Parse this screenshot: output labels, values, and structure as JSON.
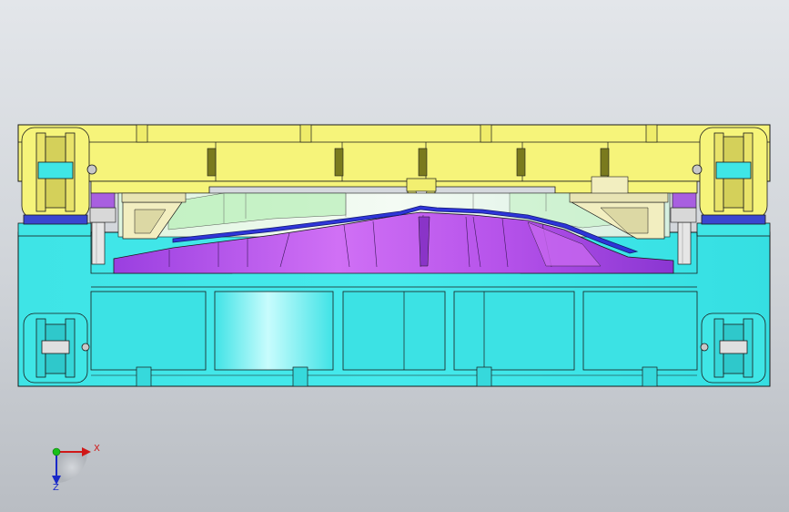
{
  "view": {
    "type": "cad-3d-section-view",
    "model": "stamping-die-assembly",
    "colors": {
      "background": "#cfd3d8",
      "upper_die": "#f6f47a",
      "lower_die": "#3fe6e6",
      "punch": "#b04de8",
      "blank": "#2e35d8",
      "guide_pin": "#e8e8e8",
      "outline": "#1a1a1a"
    }
  },
  "triad": {
    "x_label": "X",
    "y_label": "Y",
    "z_label": "Z",
    "x_color": "#d01818",
    "y_color": "#18a018",
    "z_color": "#1828c8"
  }
}
